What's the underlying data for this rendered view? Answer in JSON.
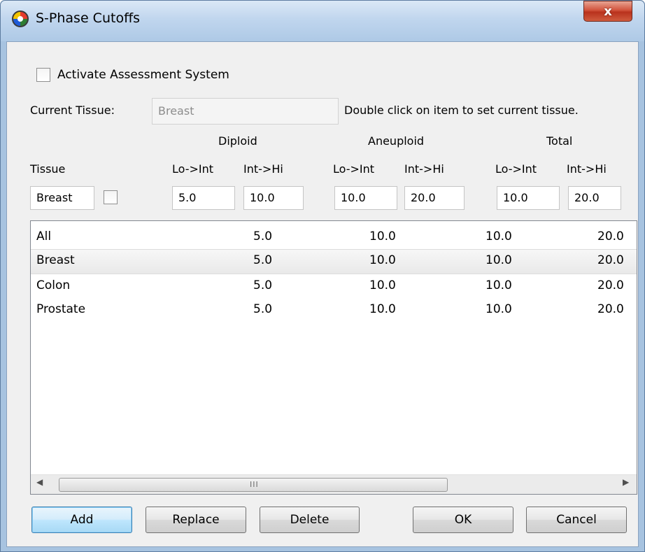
{
  "window": {
    "title": "S-Phase Cutoffs",
    "close_label": "x"
  },
  "activate": {
    "label": "Activate Assessment System",
    "checked": false
  },
  "current_tissue": {
    "label": "Current Tissue:",
    "value": "Breast",
    "hint": "Double click on item to set current tissue."
  },
  "groups": {
    "diploid": "Diploid",
    "aneuploid": "Aneuploid",
    "total": "Total"
  },
  "headers": {
    "tissue": "Tissue",
    "diploid_lo": "Lo->Int",
    "diploid_hi": "Int->Hi",
    "aneuploid_lo": "Lo->Int",
    "aneuploid_hi": "Int->Hi",
    "total_lo": "Lo->Int",
    "total_hi": "Int->Hi"
  },
  "inputs": {
    "tissue": "Breast",
    "tissue_checked": false,
    "diploid_lo": "5.0",
    "diploid_hi": "10.0",
    "aneuploid_lo": "10.0",
    "aneuploid_hi": "20.0",
    "total_lo": "10.0",
    "total_hi": "20.0"
  },
  "list": {
    "rows": [
      {
        "tissue": "All",
        "c1": "5.0",
        "c2": "10.0",
        "c3": "10.0",
        "c4": "20.0",
        "selected": false
      },
      {
        "tissue": "Breast",
        "c1": "5.0",
        "c2": "10.0",
        "c3": "10.0",
        "c4": "20.0",
        "selected": true
      },
      {
        "tissue": "Colon",
        "c1": "5.0",
        "c2": "10.0",
        "c3": "10.0",
        "c4": "20.0",
        "selected": false
      },
      {
        "tissue": "Prostate",
        "c1": "5.0",
        "c2": "10.0",
        "c3": "10.0",
        "c4": "20.0",
        "selected": false
      }
    ],
    "scroll_grip": "III"
  },
  "buttons": {
    "add": "Add",
    "replace": "Replace",
    "delete": "Delete",
    "ok": "OK",
    "cancel": "Cancel"
  },
  "icons": {
    "app": "app-logo-icon",
    "close": "close-icon",
    "scroll_left": "scroll-left-arrow-icon",
    "scroll_right": "scroll-right-arrow-icon"
  }
}
